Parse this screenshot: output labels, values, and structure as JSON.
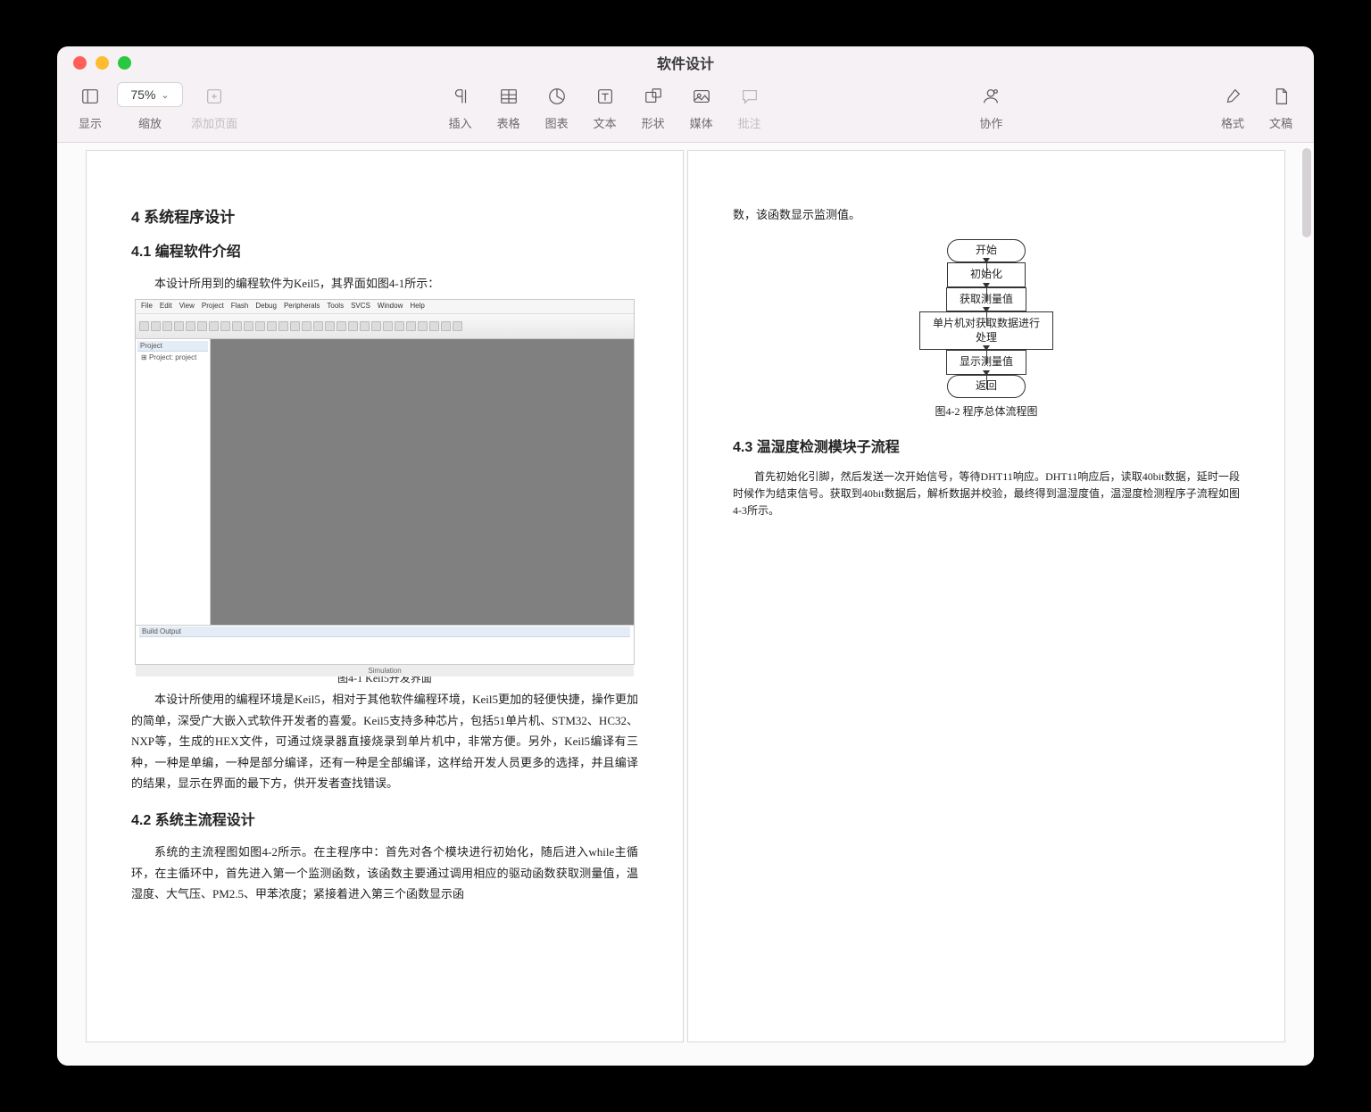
{
  "window": {
    "title": "软件设计"
  },
  "toolbar": {
    "view_label": "显示",
    "zoom_label": "缩放",
    "zoom_value": "75%",
    "add_page_label": "添加页面",
    "insert_label": "插入",
    "table_label": "表格",
    "chart_label": "图表",
    "text_label": "文本",
    "shape_label": "形状",
    "media_label": "媒体",
    "comment_label": "批注",
    "collab_label": "协作",
    "format_label": "格式",
    "document_label": "文稿"
  },
  "document": {
    "left": {
      "h2": "4 系统程序设计",
      "h3_1": "4.1 编程软件介绍",
      "p1": "本设计所用到的编程软件为Keil5，其界面如图4-1所示：",
      "keil_menu": [
        "File",
        "Edit",
        "View",
        "Project",
        "Flash",
        "Debug",
        "Peripherals",
        "Tools",
        "SVCS",
        "Window",
        "Help"
      ],
      "keil_project_title": "Project",
      "keil_project_item": "Project: project",
      "keil_output_title": "Build Output",
      "keil_status": "Simulation",
      "fig1_caption": "图4-1 Keil5开发界面",
      "p2": "本设计所使用的编程环境是Keil5，相对于其他软件编程环境，Keil5更加的轻便快捷，操作更加的简单，深受广大嵌入式软件开发者的喜爱。Keil5支持多种芯片，包括51单片机、STM32、HC32、NXP等，生成的HEX文件，可通过烧录器直接烧录到单片机中，非常方便。另外，Keil5编译有三种，一种是单编，一种是部分编译，还有一种是全部编译，这样给开发人员更多的选择，并且编译的结果，显示在界面的最下方，供开发者查找错误。",
      "h3_2": "4.2 系统主流程设计",
      "p3": "系统的主流程图如图4-2所示。在主程序中：首先对各个模块进行初始化，随后进入while主循环，在主循环中，首先进入第一个监测函数，该函数主要通过调用相应的驱动函数获取测量值，温湿度、大气压、PM2.5、甲苯浓度；紧接着进入第三个函数显示函"
    },
    "right": {
      "p_top": "数，该函数显示监测值。",
      "flow": {
        "start": "开始",
        "init": "初始化",
        "acquire": "获取测量值",
        "process": "单片机对获取数据进行处理",
        "display": "显示测量值",
        "return": "返回"
      },
      "fig2_caption": "图4-2  程序总体流程图",
      "h3_3": "4.3 温湿度检测模块子流程",
      "p4": "首先初始化引脚，然后发送一次开始信号，等待DHT11响应。DHT11响应后，读取40bit数据，延时一段时候作为结束信号。获取到40bit数据后，解析数据并校验，最终得到温湿度值，温湿度检测程序子流程如图4-3所示。"
    }
  }
}
